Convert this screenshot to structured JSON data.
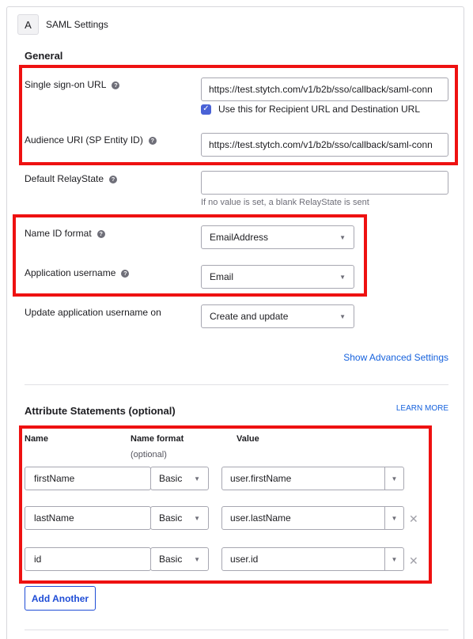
{
  "step": {
    "badge": "A",
    "title": "SAML Settings"
  },
  "general": {
    "title": "General",
    "sso_url": {
      "label": "Single sign-on URL",
      "value": "https://test.stytch.com/v1/b2b/sso/callback/saml-conn"
    },
    "recipient_checkbox": {
      "label": "Use this for Recipient URL and Destination URL",
      "checked": true
    },
    "audience_uri": {
      "label": "Audience URI (SP Entity ID)",
      "value": "https://test.stytch.com/v1/b2b/sso/callback/saml-conn"
    },
    "relay_state": {
      "label": "Default RelayState",
      "value": "",
      "hint": "If no value is set, a blank RelayState is sent"
    },
    "name_id_format": {
      "label": "Name ID format",
      "value": "EmailAddress"
    },
    "app_username": {
      "label": "Application username",
      "value": "Email"
    },
    "update_username_on": {
      "label": "Update application username on",
      "value": "Create and update"
    },
    "advanced_link": "Show Advanced Settings"
  },
  "attributes": {
    "title": "Attribute Statements (optional)",
    "learn_more": "LEARN MORE",
    "headers": {
      "name": "Name",
      "format": "Name format",
      "format_sub": "(optional)",
      "value": "Value"
    },
    "rows": [
      {
        "name": "firstName",
        "format": "Basic",
        "value": "user.firstName"
      },
      {
        "name": "lastName",
        "format": "Basic",
        "value": "user.lastName"
      },
      {
        "name": "id",
        "format": "Basic",
        "value": "user.id"
      }
    ],
    "add_another": "Add Another"
  },
  "icons": {
    "help": "?",
    "caret": "▼",
    "remove": "✕",
    "check": "✓"
  },
  "colors": {
    "accent": "#1f4dd6",
    "checkbox": "#4a62d6",
    "highlight": "#ee1111"
  }
}
